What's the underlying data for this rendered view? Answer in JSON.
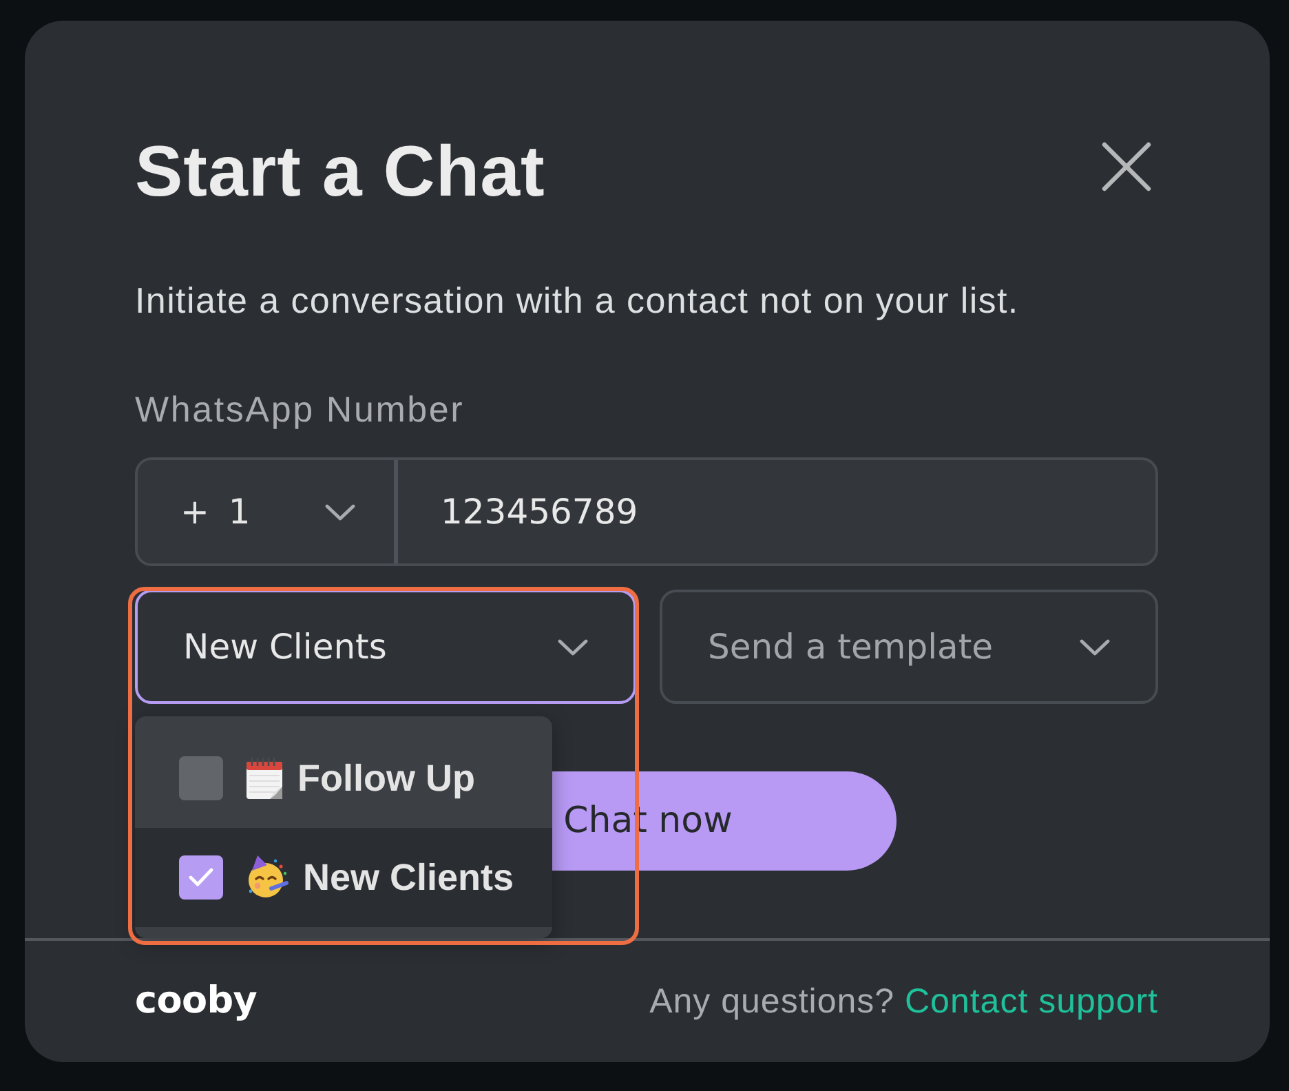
{
  "dialog": {
    "title": "Start a Chat",
    "description": "Initiate a conversation with a contact not on your list."
  },
  "phone": {
    "label": "WhatsApp Number",
    "country_code": "+ 1",
    "number": "123456789"
  },
  "tag_select": {
    "value": "New Clients",
    "focused": true,
    "expanded": true,
    "options": [
      {
        "label": "Follow Up",
        "checked": false,
        "highlighted": false
      },
      {
        "label": "New Clients",
        "checked": true,
        "highlighted": true
      }
    ]
  },
  "template_select": {
    "placeholder": "Send a template"
  },
  "primary_button": "Chat now",
  "footer": {
    "logo": "cooby",
    "question": "Any questions?",
    "link": "Contact support"
  }
}
